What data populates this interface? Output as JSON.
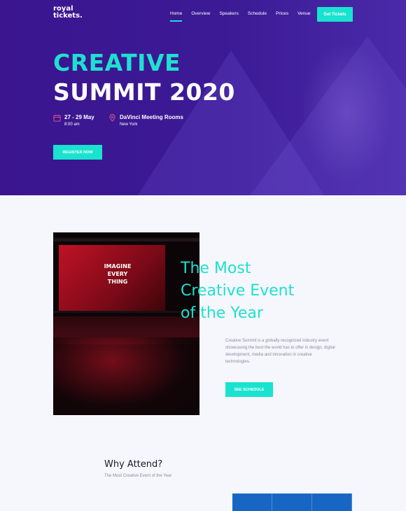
{
  "header": {
    "logo_line1": "royal",
    "logo_line2": "tickets.",
    "nav": [
      {
        "label": "Home",
        "active": true
      },
      {
        "label": "Overview",
        "active": false
      },
      {
        "label": "Speakers",
        "active": false
      },
      {
        "label": "Schedule",
        "active": false
      },
      {
        "label": "Prices",
        "active": false
      },
      {
        "label": "Venue",
        "active": false
      }
    ],
    "cta_label": "Get Tickets"
  },
  "hero": {
    "title_line1": "CREATIVE",
    "title_line2": "SUMMIT 2020",
    "date": "27 - 29 May",
    "time": "8:00 am",
    "venue": "DaVinci Meeting Rooms",
    "city": "New York",
    "register_label": "REGISTER NOW",
    "date_icon": "calendar-icon",
    "venue_icon": "location-pin-icon"
  },
  "about": {
    "image_text": [
      "IMAGINE",
      "EVERY",
      "THING"
    ],
    "title_lines": [
      "The Most",
      "Creative Event",
      "of the Year"
    ],
    "description": "Creative Summit  is a globally recognized industry event showcasing the best the world has to offer in design, digital development, media and innovation in creative technologies.",
    "button_label": "SEE SCHEDULE"
  },
  "why": {
    "title": "Why Attend?",
    "subtitle": "The Most Creative Event of the Year"
  },
  "colors": {
    "accent": "#19e3cf",
    "hero_bg": "#3a158f",
    "card_blue": "#1766c4"
  }
}
